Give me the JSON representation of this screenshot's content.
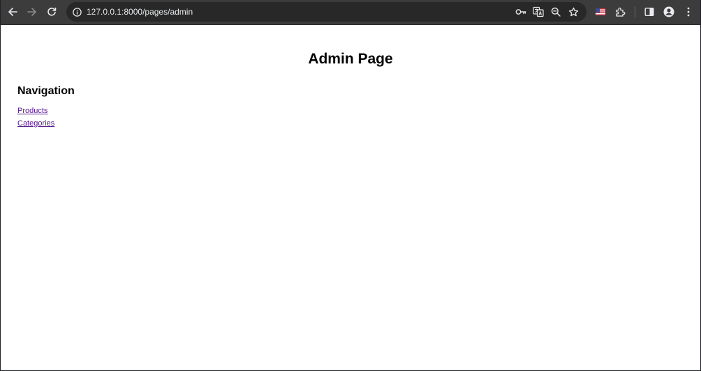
{
  "browser": {
    "url": "127.0.0.1:8000/pages/admin",
    "icons": {
      "back": "back-arrow-icon",
      "forward": "forward-arrow-icon",
      "reload": "reload-icon",
      "site_info": "site-info-icon",
      "password_key": "key-icon",
      "translate": "translate-icon",
      "zoom": "zoom-icon",
      "bookmark": "star-icon",
      "flag_extension": "us-flag-icon",
      "extensions": "puzzle-icon",
      "side_panel": "side-panel-icon",
      "profile": "profile-icon",
      "menu": "kebab-menu-icon"
    }
  },
  "page": {
    "title": "Admin Page",
    "navigation": {
      "heading": "Navigation",
      "links": [
        {
          "label": "Products"
        },
        {
          "label": "Categories"
        }
      ]
    }
  },
  "colors": {
    "toolbar_bg": "#3c3c3c",
    "omnibox_bg": "#282828",
    "visited_link": "#551a8b"
  }
}
